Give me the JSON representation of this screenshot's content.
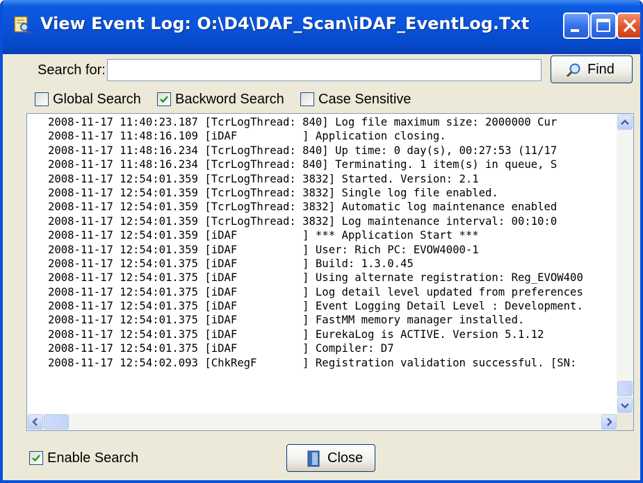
{
  "window": {
    "title": "View Event Log: O:\\D4\\DAF_Scan\\iDAF_EventLog.Txt",
    "controls": [
      "minimize-icon",
      "maximize-icon",
      "close-icon"
    ]
  },
  "search": {
    "label": "Search for:",
    "value": "",
    "find_label": "Find",
    "find_icon": "magnifier-icon"
  },
  "options": [
    {
      "label": "Global Search",
      "checked": false
    },
    {
      "label": "Backword Search",
      "checked": true
    },
    {
      "label": "Case Sensitive",
      "checked": false
    }
  ],
  "log_lines": [
    "2008-11-17 11:40:23.187 [TcrLogThread: 840] Log file maximum size: 2000000 Cur",
    "2008-11-17 11:48:16.109 [iDAF          ] Application closing.",
    "2008-11-17 11:48:16.234 [TcrLogThread: 840] Up time: 0 day(s), 00:27:53 (11/17",
    "2008-11-17 11:48:16.234 [TcrLogThread: 840] Terminating. 1 item(s) in queue, S",
    "2008-11-17 12:54:01.359 [TcrLogThread: 3832] Started. Version: 2.1",
    "2008-11-17 12:54:01.359 [TcrLogThread: 3832] Single log file enabled.",
    "2008-11-17 12:54:01.359 [TcrLogThread: 3832] Automatic log maintenance enabled",
    "2008-11-17 12:54:01.359 [TcrLogThread: 3832] Log maintenance interval: 00:10:0",
    "2008-11-17 12:54:01.359 [iDAF          ] *** Application Start ***",
    "2008-11-17 12:54:01.359 [iDAF          ] User: Rich PC: EVOW4000-1",
    "2008-11-17 12:54:01.375 [iDAF          ] Build: 1.3.0.45",
    "2008-11-17 12:54:01.375 [iDAF          ] Using alternate registration: Reg_EVOW400",
    "2008-11-17 12:54:01.375 [iDAF          ] Log detail level updated from preferences",
    "2008-11-17 12:54:01.375 [iDAF          ] Event Logging Detail Level : Development.",
    "2008-11-17 12:54:01.375 [iDAF          ] FastMM memory manager installed.",
    "2008-11-17 12:54:01.375 [iDAF          ] EurekaLog is ACTIVE. Version 5.1.12",
    "2008-11-17 12:54:01.375 [iDAF          ] Compiler: D7",
    "2008-11-17 12:54:02.093 [ChkRegF       ] Registration validation successful. [SN:"
  ],
  "footer": {
    "enable_search_label": "Enable Search",
    "enable_search_checked": true,
    "close_label": "Close",
    "close_icon": "door-exit-icon"
  },
  "colors": {
    "titlebar": "#0a53da",
    "face": "#ece9d8",
    "close_button": "#e0552c"
  }
}
